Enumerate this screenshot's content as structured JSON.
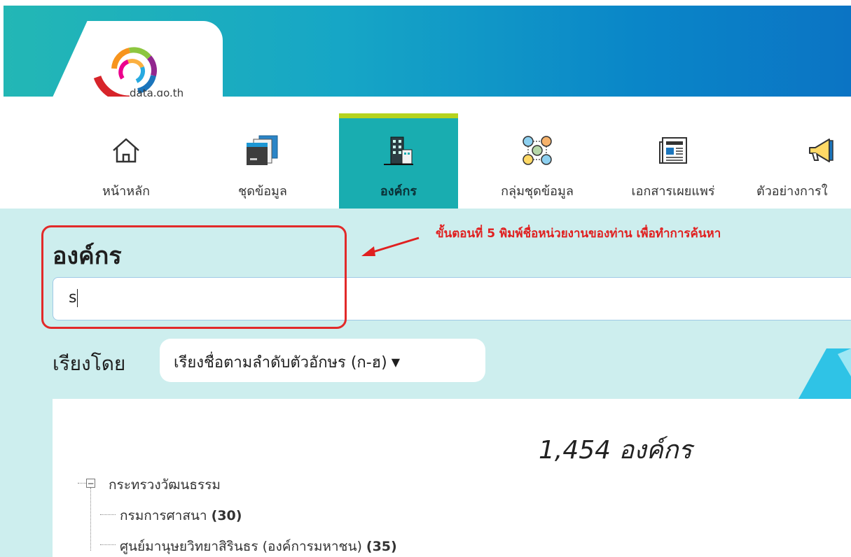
{
  "header": {
    "logo_text": "data.go.th"
  },
  "nav": {
    "items": [
      {
        "label": "หน้าหลัก",
        "icon": "home-icon"
      },
      {
        "label": "ชุดข้อมูล",
        "icon": "folders-icon"
      },
      {
        "label": "องค์กร",
        "icon": "building-icon",
        "active": true
      },
      {
        "label": "กลุ่มชุดข้อมูล",
        "icon": "people-network-icon"
      },
      {
        "label": "เอกสารเผยแพร่",
        "icon": "newspaper-icon"
      },
      {
        "label": "ตัวอย่างการใ",
        "icon": "megaphone-icon"
      }
    ],
    "active_bar_color": "#b6d31e",
    "active_bg_color": "#19adb0"
  },
  "page": {
    "title": "องค์กร",
    "search": {
      "value": "s"
    },
    "annotation": {
      "text": "ขั้นตอนที่ 5 พิมพ์ชื่อหน่วยงานของท่าน เพื่อทำการค้นหา",
      "color": "#e02020"
    },
    "sort": {
      "label": "เรียงโดย",
      "selected": "เรียงชื่อตามลำดับตัวอักษร (ก-ฮ)"
    },
    "result_count": "1,454 องค์กร",
    "tree": {
      "parent": {
        "label": "กระทรวงวัฒนธรรม",
        "toggle": "−"
      },
      "children": [
        {
          "label": "กรมการศาสนา",
          "count": "(30)"
        },
        {
          "label": "ศูนย์มานุษยวิทยาสิรินธร (องค์การมหาชน)",
          "count": "(35)"
        }
      ]
    }
  }
}
